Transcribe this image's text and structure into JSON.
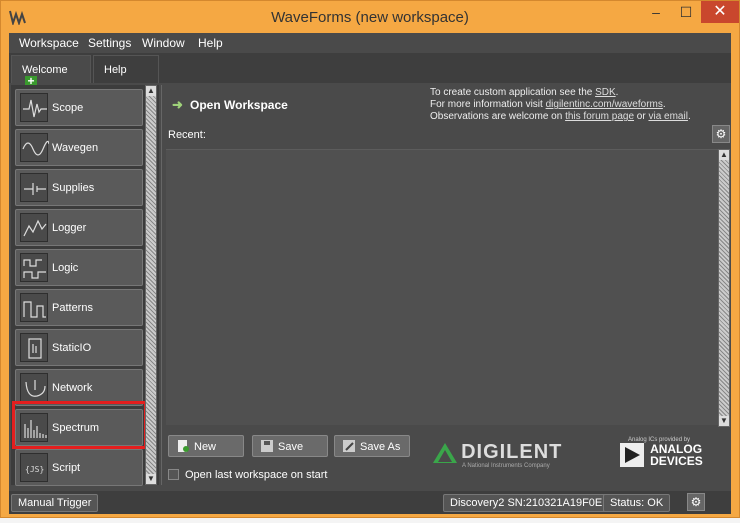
{
  "window": {
    "title": "WaveForms  (new workspace)"
  },
  "menu": [
    "Workspace",
    "Settings",
    "Window",
    "Help"
  ],
  "tabs": {
    "welcome": "Welcome",
    "help": "Help"
  },
  "tools": [
    {
      "label": "Scope",
      "icon": "oscilloscope-icon"
    },
    {
      "label": "Wavegen",
      "icon": "sine-wave-icon"
    },
    {
      "label": "Supplies",
      "icon": "battery-icon"
    },
    {
      "label": "Logger",
      "icon": "logger-graph-icon"
    },
    {
      "label": "Logic",
      "icon": "logic-analyzer-icon"
    },
    {
      "label": "Patterns",
      "icon": "pattern-generator-icon"
    },
    {
      "label": "StaticIO",
      "icon": "static-io-icon"
    },
    {
      "label": "Network",
      "icon": "network-analyzer-icon"
    },
    {
      "label": "Spectrum",
      "icon": "spectrum-icon"
    },
    {
      "label": "Script",
      "icon": "script-icon"
    }
  ],
  "main": {
    "open_workspace": "Open Workspace",
    "info_line1_prefix": "To create custom application see the ",
    "info_line1_link": "SDK",
    "info_line1_suffix": ".",
    "info_line2_prefix": "For more information visit ",
    "info_line2_link": "digilentinc.com/waveforms",
    "info_line2_suffix": ".",
    "info_line3_prefix": "Observations are welcome on ",
    "info_line3_link1": "this forum page",
    "info_line3_mid": " or ",
    "info_line3_link2": "via email",
    "info_line3_suffix": ".",
    "recent_label": "Recent:",
    "new_label": "New",
    "save_label": "Save",
    "save_as_label": "Save As",
    "open_last_label": "Open last workspace on start"
  },
  "branding": {
    "digilent": "DIGILENT",
    "digilent_sub": "A National Instruments Company",
    "adi_pre": "Analog ICs provided by",
    "adi_line1": "ANALOG",
    "adi_line2": "DEVICES"
  },
  "status": {
    "manual_trigger": "Manual Trigger",
    "device": "Discovery2 SN:210321A19F0E",
    "status": "Status: OK"
  },
  "colors": {
    "titlebar": "#f5a843",
    "close": "#c9472d",
    "highlight": "#e41e1e",
    "panel": "#4a4a4a"
  }
}
